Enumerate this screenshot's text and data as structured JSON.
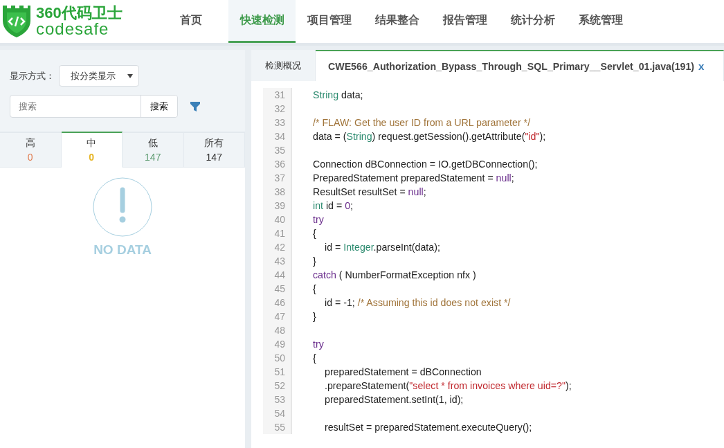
{
  "logo": {
    "title": "360代码卫士",
    "subtitle": "codesafe"
  },
  "nav": [
    {
      "label": "首页",
      "selected": false
    },
    {
      "label": "快速检测",
      "selected": true
    },
    {
      "label": "项目管理",
      "selected": false
    },
    {
      "label": "结果整合",
      "selected": false
    },
    {
      "label": "报告管理",
      "selected": false
    },
    {
      "label": "统计分析",
      "selected": false
    },
    {
      "label": "系统管理",
      "selected": false
    }
  ],
  "sidebar": {
    "display_label": "显示方式：",
    "display_value": "按分类显示",
    "search_placeholder": "搜索",
    "search_button": "搜索",
    "severity_tabs": [
      {
        "label": "高",
        "count": "0",
        "color": "#e07b4f",
        "selected": false
      },
      {
        "label": "中",
        "count": "0",
        "color": "#e6b422",
        "selected": true
      },
      {
        "label": "低",
        "count": "147",
        "color": "#5f9c72",
        "selected": false
      },
      {
        "label": "所有",
        "count": "147",
        "color": "#333333",
        "selected": false
      }
    ],
    "empty_text": "NO DATA"
  },
  "tabs": [
    {
      "label": "检测概况",
      "selected": false
    },
    {
      "label": "CWE566_Authorization_Bypass_Through_SQL_Primary__Servlet_01.java(191)",
      "selected": true,
      "close": "x"
    }
  ],
  "code_lines": [
    {
      "number": "31",
      "indented": false,
      "tokens": [
        {
          "kind": "type",
          "text": "String"
        },
        {
          "kind": "plain",
          "text": " data;"
        }
      ]
    },
    {
      "number": "32"
    },
    {
      "number": "33",
      "indented": false,
      "tokens": [
        {
          "kind": "comment",
          "text": "/* FLAW: Get the user ID from a URL parameter */"
        }
      ]
    },
    {
      "number": "34",
      "indented": false,
      "tokens": [
        {
          "kind": "plain",
          "text": "data = ("
        },
        {
          "kind": "type",
          "text": "String"
        },
        {
          "kind": "plain",
          "text": ") request.getSession().getAttribute("
        },
        {
          "kind": "string",
          "text": "\"id\""
        },
        {
          "kind": "plain",
          "text": ");"
        }
      ]
    },
    {
      "number": "35"
    },
    {
      "number": "36",
      "indented": false,
      "tokens": [
        {
          "kind": "plain",
          "text": "Connection dBConnection = IO.getDBConnection();"
        }
      ]
    },
    {
      "number": "37",
      "indented": false,
      "tokens": [
        {
          "kind": "plain",
          "text": "PreparedStatement preparedStatement = "
        },
        {
          "kind": "keyword",
          "text": "null"
        },
        {
          "kind": "plain",
          "text": ";"
        }
      ]
    },
    {
      "number": "38",
      "indented": false,
      "tokens": [
        {
          "kind": "plain",
          "text": "ResultSet resultSet = "
        },
        {
          "kind": "keyword",
          "text": "null"
        },
        {
          "kind": "plain",
          "text": ";"
        }
      ]
    },
    {
      "number": "39",
      "indented": false,
      "tokens": [
        {
          "kind": "type",
          "text": "int"
        },
        {
          "kind": "plain",
          "text": " id = "
        },
        {
          "kind": "keyword",
          "text": "0"
        },
        {
          "kind": "plain",
          "text": ";"
        }
      ]
    },
    {
      "number": "40",
      "indented": false,
      "tokens": [
        {
          "kind": "keyword",
          "text": "try"
        }
      ]
    },
    {
      "number": "41",
      "indented": false,
      "tokens": [
        {
          "kind": "plain",
          "text": "{"
        }
      ]
    },
    {
      "number": "42",
      "indented": true,
      "tokens": [
        {
          "kind": "plain",
          "text": "id = "
        },
        {
          "kind": "type",
          "text": "Integer"
        },
        {
          "kind": "plain",
          "text": ".parseInt(data);"
        }
      ]
    },
    {
      "number": "43",
      "indented": false,
      "tokens": [
        {
          "kind": "plain",
          "text": "}"
        }
      ]
    },
    {
      "number": "44",
      "indented": false,
      "tokens": [
        {
          "kind": "keyword",
          "text": "catch"
        },
        {
          "kind": "plain",
          "text": " ( NumberFormatException nfx )"
        }
      ]
    },
    {
      "number": "45",
      "indented": false,
      "tokens": [
        {
          "kind": "plain",
          "text": "{"
        }
      ]
    },
    {
      "number": "46",
      "indented": true,
      "tokens": [
        {
          "kind": "plain",
          "text": "id = -1; "
        },
        {
          "kind": "comment",
          "text": "/* Assuming this id does not exist */"
        }
      ]
    },
    {
      "number": "47",
      "indented": false,
      "tokens": [
        {
          "kind": "plain",
          "text": "}"
        }
      ]
    },
    {
      "number": "48"
    },
    {
      "number": "49",
      "indented": false,
      "tokens": [
        {
          "kind": "keyword",
          "text": "try"
        }
      ]
    },
    {
      "number": "50",
      "indented": false,
      "tokens": [
        {
          "kind": "plain",
          "text": "{"
        }
      ]
    },
    {
      "number": "51",
      "indented": true,
      "tokens": [
        {
          "kind": "plain",
          "text": "preparedStatement = dBConnection"
        }
      ]
    },
    {
      "number": "52",
      "indented": true,
      "tokens": [
        {
          "kind": "plain",
          "text": ".prepareStatement("
        },
        {
          "kind": "string",
          "text": "\"select * from invoices where uid=?\""
        },
        {
          "kind": "plain",
          "text": ");"
        }
      ]
    },
    {
      "number": "53",
      "indented": true,
      "tokens": [
        {
          "kind": "plain",
          "text": "preparedStatement.setInt(1, id);"
        }
      ]
    },
    {
      "number": "54"
    },
    {
      "number": "55",
      "indented": true,
      "tokens": [
        {
          "kind": "plain",
          "text": "resultSet = preparedStatement.executeQuery();"
        }
      ]
    }
  ]
}
